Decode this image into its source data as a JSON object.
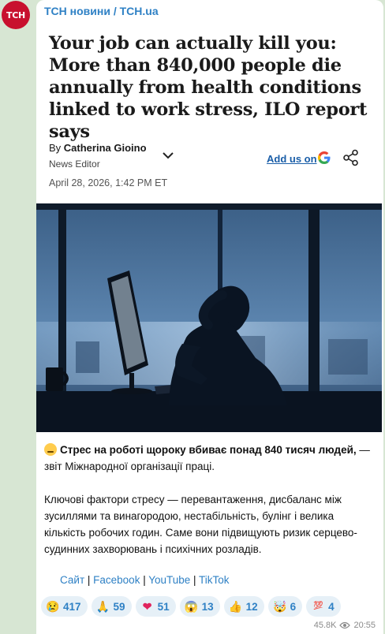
{
  "channel": {
    "avatar_text": "ТСН",
    "name": "ТСН новини / TCH.ua"
  },
  "article": {
    "headline": "Your job can actually kill you: More than 840,000 people die annually from health conditions linked to work stress, ILO report says",
    "by_prefix": "By",
    "author": "Catherina Gioino",
    "role": "News Editor",
    "add_us": "Add us on",
    "date": "April 28, 2026, 1:42 PM ET"
  },
  "message": {
    "lead_bold": "Стрес на роботі щороку вбиває понад 840 тисяч людей,",
    "lead_rest": " — звіт Міжнародної організації праці.",
    "body": "Ключові фактори стресу — перевантаження, дисбаланс між зусиллями та винагородою, нестабільність, булінг і велика кількість робочих годин. Саме вони підвищують ризик серцево-судинних захворювань і психічних розладів."
  },
  "links": {
    "site": "Сайт",
    "facebook": "Facebook",
    "youtube": "YouTube",
    "tiktok": "TikTok",
    "sep": " | "
  },
  "reactions": [
    {
      "icon": "crying-face",
      "glyph": "😢",
      "count": "417"
    },
    {
      "icon": "folded-hands",
      "glyph": "🙏",
      "count": "59"
    },
    {
      "icon": "red-heart",
      "glyph": "❤",
      "count": "51"
    },
    {
      "icon": "screaming-face",
      "glyph": "😱",
      "count": "13"
    },
    {
      "icon": "thumbs-up",
      "glyph": "👍",
      "count": "12"
    },
    {
      "icon": "exploding-head",
      "glyph": "🤯",
      "count": "6"
    },
    {
      "icon": "hundred-points",
      "glyph": "💯",
      "count": "4"
    }
  ],
  "meta": {
    "views": "45.8K",
    "time": "20:55"
  },
  "colors": {
    "accent": "#2f81c5",
    "brand_red": "#c8102e",
    "chat_bg": "#d7e6d3"
  }
}
